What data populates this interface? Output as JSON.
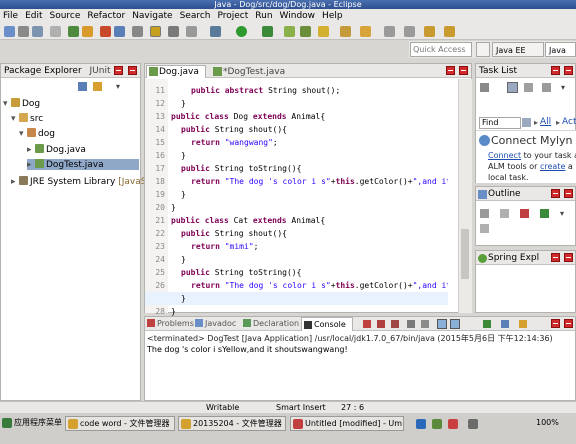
{
  "window": {
    "title": "Java - Dog/src/dog/Dog.java - Eclipse"
  },
  "menu": [
    "File",
    "Edit",
    "Source",
    "Refactor",
    "Navigate",
    "Search",
    "Project",
    "Run",
    "Window",
    "Help"
  ],
  "quick_access": {
    "placeholder": "Quick Access"
  },
  "perspectives": {
    "java_ee": "Java EE",
    "java": "Java"
  },
  "package_explorer": {
    "title": "Package Explorer",
    "tab2": "JUnit",
    "tree": {
      "project": "Dog",
      "src": "src",
      "package": "dog",
      "file1": "Dog.java",
      "file2": "DogTest.java",
      "jre": "JRE System Library",
      "jre_version": "[JavaSE-1.7]"
    }
  },
  "editor": {
    "tabs": {
      "tab1": "Dog.java",
      "tab2": "*DogTest.java"
    },
    "line_numbers": [
      "11",
      "12",
      "13",
      "14",
      "15",
      "16",
      "17",
      "18",
      "19",
      "20",
      "21",
      "22",
      "23",
      "24",
      "25",
      "26",
      "27",
      "28",
      "29",
      "30"
    ],
    "lines": [
      {
        "k": "public abstract",
        "t": " String shout();",
        "s": ""
      },
      {
        "k": "",
        "t": "}",
        "s": ""
      },
      {
        "k": "public class",
        "t": " Dog ",
        "k2": "extends",
        "t2": " Animal{"
      },
      {
        "k": "public",
        "t": " String shout(){",
        "s": ""
      },
      {
        "k": "return",
        "t": " ",
        "s": "\"wangwang\"",
        "t2": ";"
      },
      {
        "k": "",
        "t": "}",
        "s": ""
      },
      {
        "k": "public",
        "t": " String toString(){",
        "s": ""
      },
      {
        "k": "return",
        "t": " ",
        "s": "\"The dog 's color i s\"",
        "t2": "+",
        "k2": "this",
        "t3": ".getColor()+",
        "s2": "\",and it shouts\"",
        "t4": "+",
        "k3": "this",
        "t5": ".bark()"
      },
      {
        "k": "",
        "t": "}",
        "s": ""
      },
      {
        "k": "",
        "t": "}",
        "s": ""
      },
      {
        "k": "public class",
        "t": " Cat ",
        "k2": "extends",
        "t2": " Animal{"
      },
      {
        "k": "public",
        "t": " String shout(){",
        "s": ""
      },
      {
        "k": "return",
        "t": " ",
        "s": "\"mimi\"",
        "t2": ";"
      },
      {
        "k": "",
        "t": "}",
        "s": ""
      },
      {
        "k": "public",
        "t": " String toString(){",
        "s": ""
      },
      {
        "k": "return",
        "t": " ",
        "s": "\"The dog 's color i s\"",
        "t2": "+",
        "k2": "this",
        "t3": ".getColor()+",
        "s2": "\",and it shouts\"",
        "t4": "+",
        "k3": "this",
        "t5": ".bark()"
      },
      {
        "k": "",
        "t": "}",
        "s": ""
      },
      {
        "k": "",
        "t": "}",
        "s": ""
      },
      {
        "k": "",
        "t": "",
        "s": ""
      },
      {
        "k": "",
        "t": "",
        "s": ""
      }
    ]
  },
  "task_list": {
    "title": "Task List",
    "find_placeholder": "Find",
    "all": "All",
    "activate": "Acti..."
  },
  "mylyn": {
    "title": "Connect Mylyn",
    "line1_link": "Connect",
    "line1_rest": " to your task and",
    "line2_a": "ALM tools or ",
    "line2_link": "create",
    "line2_b": " a",
    "line3": "local task."
  },
  "outline": {
    "title": "Outline"
  },
  "spring": {
    "title": "Spring Expl"
  },
  "bottom": {
    "tabs": {
      "problems": "Problems",
      "javadoc": "Javadoc",
      "declaration": "Declaration",
      "console": "Console"
    },
    "terminated": "<terminated> DogTest [Java Application] /usr/local/jdk1.7.0_67/bin/java (2015年5月6日 下午12:14:36)",
    "output": "The dog 's color i sYellow,and it shoutswangwang!"
  },
  "status": {
    "writable": "Writable",
    "insert": "Smart Insert",
    "position": "27 : 6"
  },
  "taskbar": {
    "start": "应用程序菜单",
    "items": [
      "code word - 文件管理器",
      "20135204 - 文件管理器",
      "Untitled [modified] - Um..."
    ],
    "tray": "100%"
  },
  "colors": {
    "accent": "#2c4f8f",
    "keyword": "#7f0055",
    "string": "#2a00ff",
    "close_red": "#d12a2a"
  }
}
